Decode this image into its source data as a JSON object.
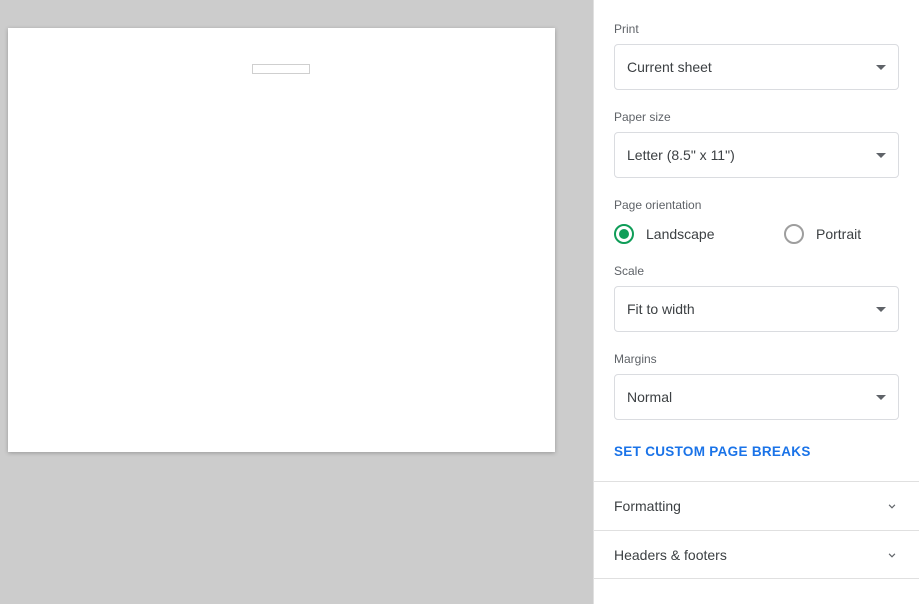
{
  "settings": {
    "print": {
      "label": "Print",
      "value": "Current sheet"
    },
    "paperSize": {
      "label": "Paper size",
      "value": "Letter (8.5\" x 11\")"
    },
    "orientation": {
      "label": "Page orientation",
      "options": {
        "landscape": "Landscape",
        "portrait": "Portrait"
      },
      "selected": "landscape"
    },
    "scale": {
      "label": "Scale",
      "value": "Fit to width"
    },
    "margins": {
      "label": "Margins",
      "value": "Normal"
    },
    "customPageBreaks": "SET CUSTOM PAGE BREAKS"
  },
  "collapsibles": {
    "formatting": "Formatting",
    "headersFooters": "Headers & footers"
  }
}
